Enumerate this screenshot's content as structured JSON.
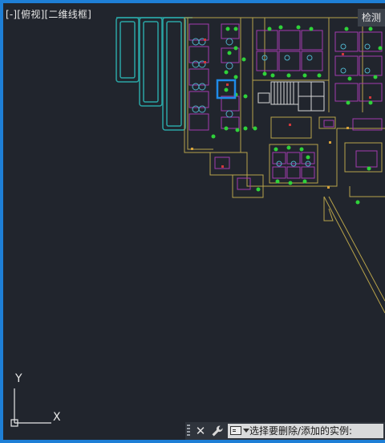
{
  "viewport": {
    "label": "[-][俯视][二维线框]",
    "view_cube_button": "检测",
    "ucs": {
      "x_axis": "X",
      "y_axis": "Y"
    }
  },
  "command_line": {
    "close_glyph": "✕",
    "prompt": "选择要删除/添加的实例:"
  },
  "colors": {
    "background": "#21252d",
    "frame": "#1e7fd6",
    "wall_yellow": "#b8a34a",
    "furniture_magenta": "#a33bb0",
    "plant_green": "#2fd23a",
    "stair_white": "#d8d8d8",
    "cyan_block": "#2aa5a5",
    "selection_blue": "#1f8be8"
  }
}
